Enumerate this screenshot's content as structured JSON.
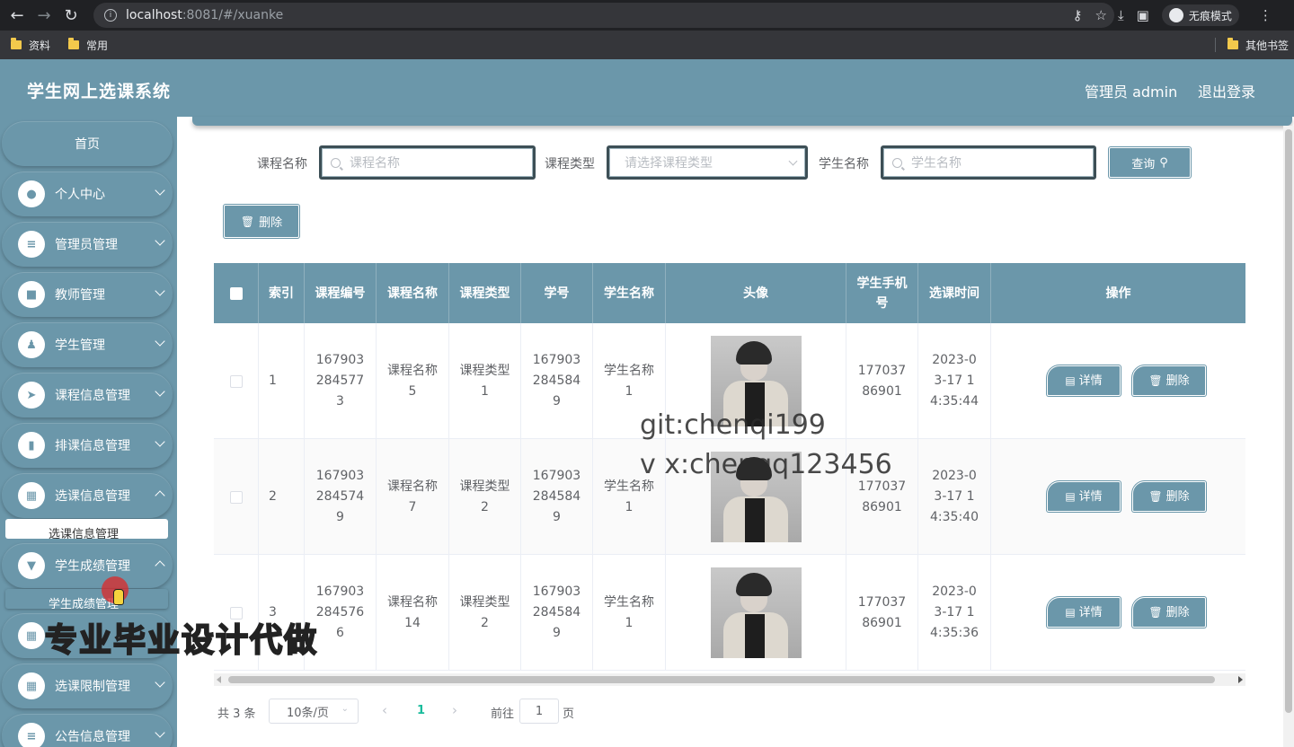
{
  "browser": {
    "url_host": "localhost",
    "url_rest": ":8081/#/xuanke",
    "incognito_label": "无痕模式",
    "bookmarks": [
      "资料",
      "常用"
    ],
    "other_bookmarks": "其他书签"
  },
  "header": {
    "title": "学生网上选课系统",
    "user": "管理员 admin",
    "logout": "退出登录"
  },
  "sidebar": {
    "home": "首页",
    "items": [
      {
        "label": "个人中心",
        "icon": "user-icon"
      },
      {
        "label": "管理员管理",
        "icon": "list-icon"
      },
      {
        "label": "教师管理",
        "icon": "briefcase-icon"
      },
      {
        "label": "学生管理",
        "icon": "person-icon"
      },
      {
        "label": "课程信息管理",
        "icon": "send-icon"
      },
      {
        "label": "排课信息管理",
        "icon": "bar-chart-icon"
      },
      {
        "label": "选课信息管理",
        "icon": "grid-icon"
      },
      {
        "label": "学生成绩管理",
        "icon": "pin-icon"
      },
      {
        "label": "选课限制管理",
        "icon": "grid-icon"
      },
      {
        "label": "公告信息管理",
        "icon": "sliders-icon"
      }
    ],
    "submenu_xuanke": "选课信息管理",
    "submenu_chengji": "学生成绩管理"
  },
  "filters": {
    "course_name_label": "课程名称",
    "course_name_placeholder": "课程名称",
    "course_type_label": "课程类型",
    "course_type_placeholder": "请选择课程类型",
    "student_name_label": "学生名称",
    "student_name_placeholder": "学生名称",
    "query_button": "查询",
    "delete_button": "删除"
  },
  "table": {
    "headers": [
      "索引",
      "课程编号",
      "课程名称",
      "课程类型",
      "学号",
      "学生名称",
      "头像",
      "学生手机号",
      "选课时间",
      "操作"
    ],
    "rows": [
      {
        "index": "1",
        "course_no": "1679032845773",
        "course_name": "课程名称5",
        "course_type": "课程类型1",
        "student_no": "1679032845849",
        "student_name": "学生名称1",
        "phone": "17703786901",
        "time": "2023-03-17 14:35:44"
      },
      {
        "index": "2",
        "course_no": "1679032845749",
        "course_name": "课程名称7",
        "course_type": "课程类型2",
        "student_no": "1679032845849",
        "student_name": "学生名称1",
        "phone": "17703786901",
        "time": "2023-03-17 14:35:40"
      },
      {
        "index": "3",
        "course_no": "1679032845766",
        "course_name": "课程名称14",
        "course_type": "课程类型2",
        "student_no": "1679032845849",
        "student_name": "学生名称1",
        "phone": "17703786901",
        "time": "2023-03-17 14:35:36"
      }
    ],
    "detail_button": "详情",
    "delete_button": "删除"
  },
  "pagination": {
    "total": "共 3 条",
    "page_size": "10条/页",
    "current_page": "1",
    "goto_label": "前往",
    "goto_value": "1",
    "page_suffix": "页"
  },
  "overlay": {
    "watermark_git": "git:chenqi199",
    "watermark_vx": "v x:chenqq123456",
    "promo": "专业毕业设计代做"
  },
  "colors": {
    "primary": "#6b97aa",
    "pagination_active": "#1abc9c"
  }
}
